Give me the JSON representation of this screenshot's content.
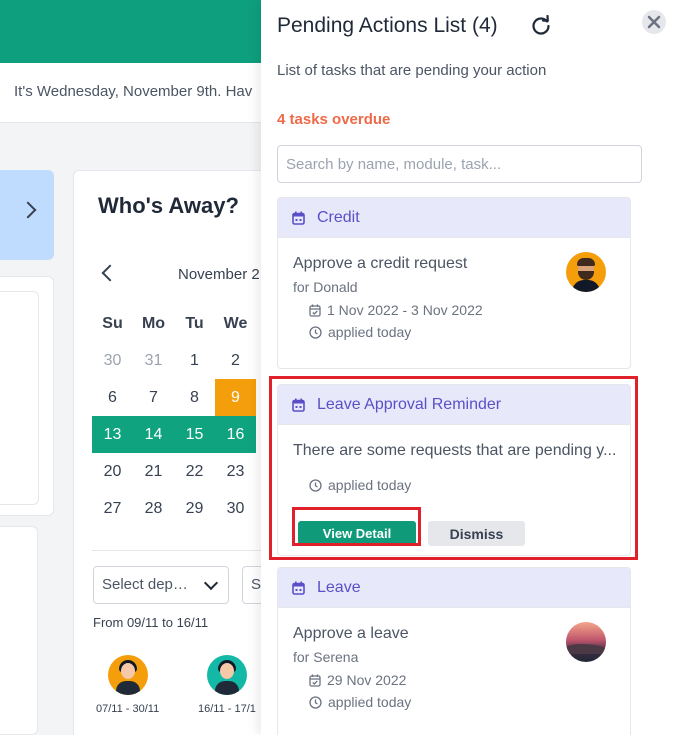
{
  "greeting": "It's Wednesday, November 9th. Hav",
  "away": {
    "title": "Who's Away?",
    "month": "November 2",
    "weekdays": [
      "Su",
      "Mo",
      "Tu",
      "We"
    ],
    "weeks": [
      [
        "30",
        "31",
        "1",
        "2"
      ],
      [
        "6",
        "7",
        "8",
        "9"
      ],
      [
        "13",
        "14",
        "15",
        "16"
      ],
      [
        "20",
        "21",
        "22",
        "23"
      ],
      [
        "27",
        "28",
        "29",
        "30"
      ]
    ],
    "today": "9",
    "away_days": [
      "13",
      "14",
      "15",
      "16"
    ],
    "department_select": "Select dep…",
    "second_select": "S",
    "range": "From 09/11 to 16/11",
    "people": [
      {
        "dates": "07/11 - 30/11"
      },
      {
        "dates": "16/11 - 17/1"
      }
    ]
  },
  "drawer": {
    "title": "Pending Actions List (4)",
    "description": "List of tasks that are pending your action",
    "overdue": "4 tasks overdue",
    "search_placeholder": "Search by name, module, task..."
  },
  "tasks": [
    {
      "module": "Credit",
      "text": "Approve a credit request",
      "for": "for Donald",
      "dates": "1 Nov 2022 - 3 Nov 2022",
      "applied": "applied today"
    },
    {
      "module": "Leave Approval Reminder",
      "text": "There are some requests that are pending y...",
      "applied": "applied today",
      "primary_action": "View Detail",
      "secondary_action": "Dismiss"
    },
    {
      "module": "Leave",
      "text": "Approve a leave",
      "for": "for Serena",
      "dates": "29 Nov 2022",
      "applied": "applied today"
    }
  ],
  "colors": {
    "brand": "#0e9f7e",
    "accent_purple": "#5b4fc7",
    "overdue": "#ef6a47",
    "today": "#f59e0b",
    "highlight": "#e0202a"
  }
}
